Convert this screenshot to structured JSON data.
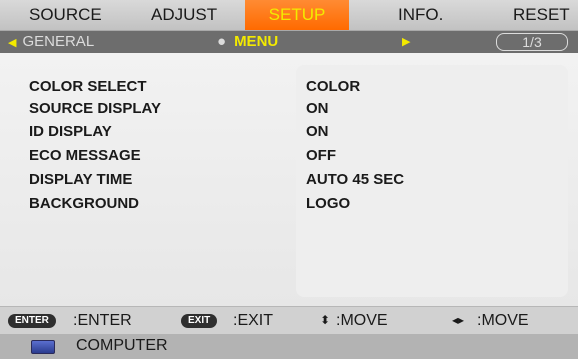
{
  "tabs": {
    "source": "SOURCE",
    "adjust": "ADJUST",
    "setup": "SETUP",
    "info": "INFO.",
    "reset": "RESET"
  },
  "submenu": {
    "general": "GENERAL",
    "menu": "MENU",
    "page": "1/3"
  },
  "settings": [
    {
      "label": "COLOR SELECT",
      "value": "COLOR"
    },
    {
      "label": "SOURCE DISPLAY",
      "value": "ON"
    },
    {
      "label": "ID DISPLAY",
      "value": "ON"
    },
    {
      "label": "ECO MESSAGE",
      "value": "OFF"
    },
    {
      "label": "DISPLAY TIME",
      "value": "AUTO 45 SEC"
    },
    {
      "label": "BACKGROUND",
      "value": "LOGO"
    }
  ],
  "hints": {
    "enter_key": "ENTER",
    "enter_text": ":ENTER",
    "exit_key": "EXIT",
    "exit_text": ":EXIT",
    "move_vertical_text": ":MOVE",
    "move_horizontal_text": ":MOVE"
  },
  "source": {
    "label": "COMPUTER"
  },
  "colors": {
    "active_tab": "#ff6a00",
    "active_text": "#f3ea00",
    "submenu_bg": "#6d6d6d"
  }
}
